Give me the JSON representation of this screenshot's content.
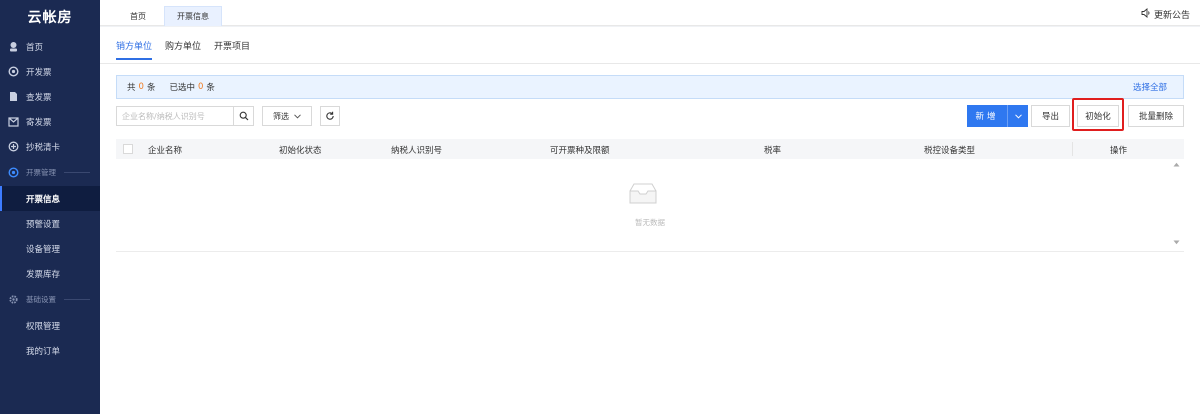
{
  "app": {
    "logo": "云帐房"
  },
  "sidebar": {
    "items": [
      {
        "label": "首页",
        "icon": "home-icon"
      },
      {
        "label": "开发票",
        "icon": "issue-invoice-icon"
      },
      {
        "label": "查发票",
        "icon": "search-invoice-icon"
      },
      {
        "label": "寄发票",
        "icon": "mail-invoice-icon"
      },
      {
        "label": "抄税清卡",
        "icon": "tax-copy-icon"
      }
    ],
    "group1": {
      "label": "开票管理",
      "icon": "invoice-manage-icon"
    },
    "group1_items": [
      {
        "label": "开票信息",
        "active": true
      },
      {
        "label": "预警设置"
      },
      {
        "label": "设备管理"
      },
      {
        "label": "发票库存"
      }
    ],
    "group2": {
      "label": "基础设置",
      "icon": "settings-icon"
    },
    "group2_items": [
      {
        "label": "权限管理"
      },
      {
        "label": "我的订单"
      }
    ]
  },
  "topbar": {
    "tabs": [
      {
        "label": "首页"
      },
      {
        "label": "开票信息",
        "active": true
      }
    ],
    "announcement": "更新公告"
  },
  "subtabs": [
    {
      "label": "销方单位",
      "active": true
    },
    {
      "label": "购方单位"
    },
    {
      "label": "开票项目"
    }
  ],
  "info": {
    "total_prefix": "共",
    "total": "0",
    "total_suffix": "条",
    "selected_prefix": "已选中",
    "selected": "0",
    "selected_suffix": "条",
    "select_all": "选择全部"
  },
  "toolbar": {
    "search_placeholder": "企业名称/纳税人识别号",
    "filter_label": "筛选",
    "new_label": "新增",
    "export_label": "导出",
    "init_label": "初始化",
    "batch_delete_label": "批量删除"
  },
  "table": {
    "columns": [
      "企业名称",
      "初始化状态",
      "纳税人识别号",
      "可开票种及限额",
      "税率",
      "税控设备类型",
      "操作"
    ],
    "empty_text": "暂无数据"
  },
  "colors": {
    "primary": "#2f78f0",
    "sidebar_bg": "#1b2a52",
    "highlight": "#e01e1e",
    "count": "#f07b22"
  }
}
